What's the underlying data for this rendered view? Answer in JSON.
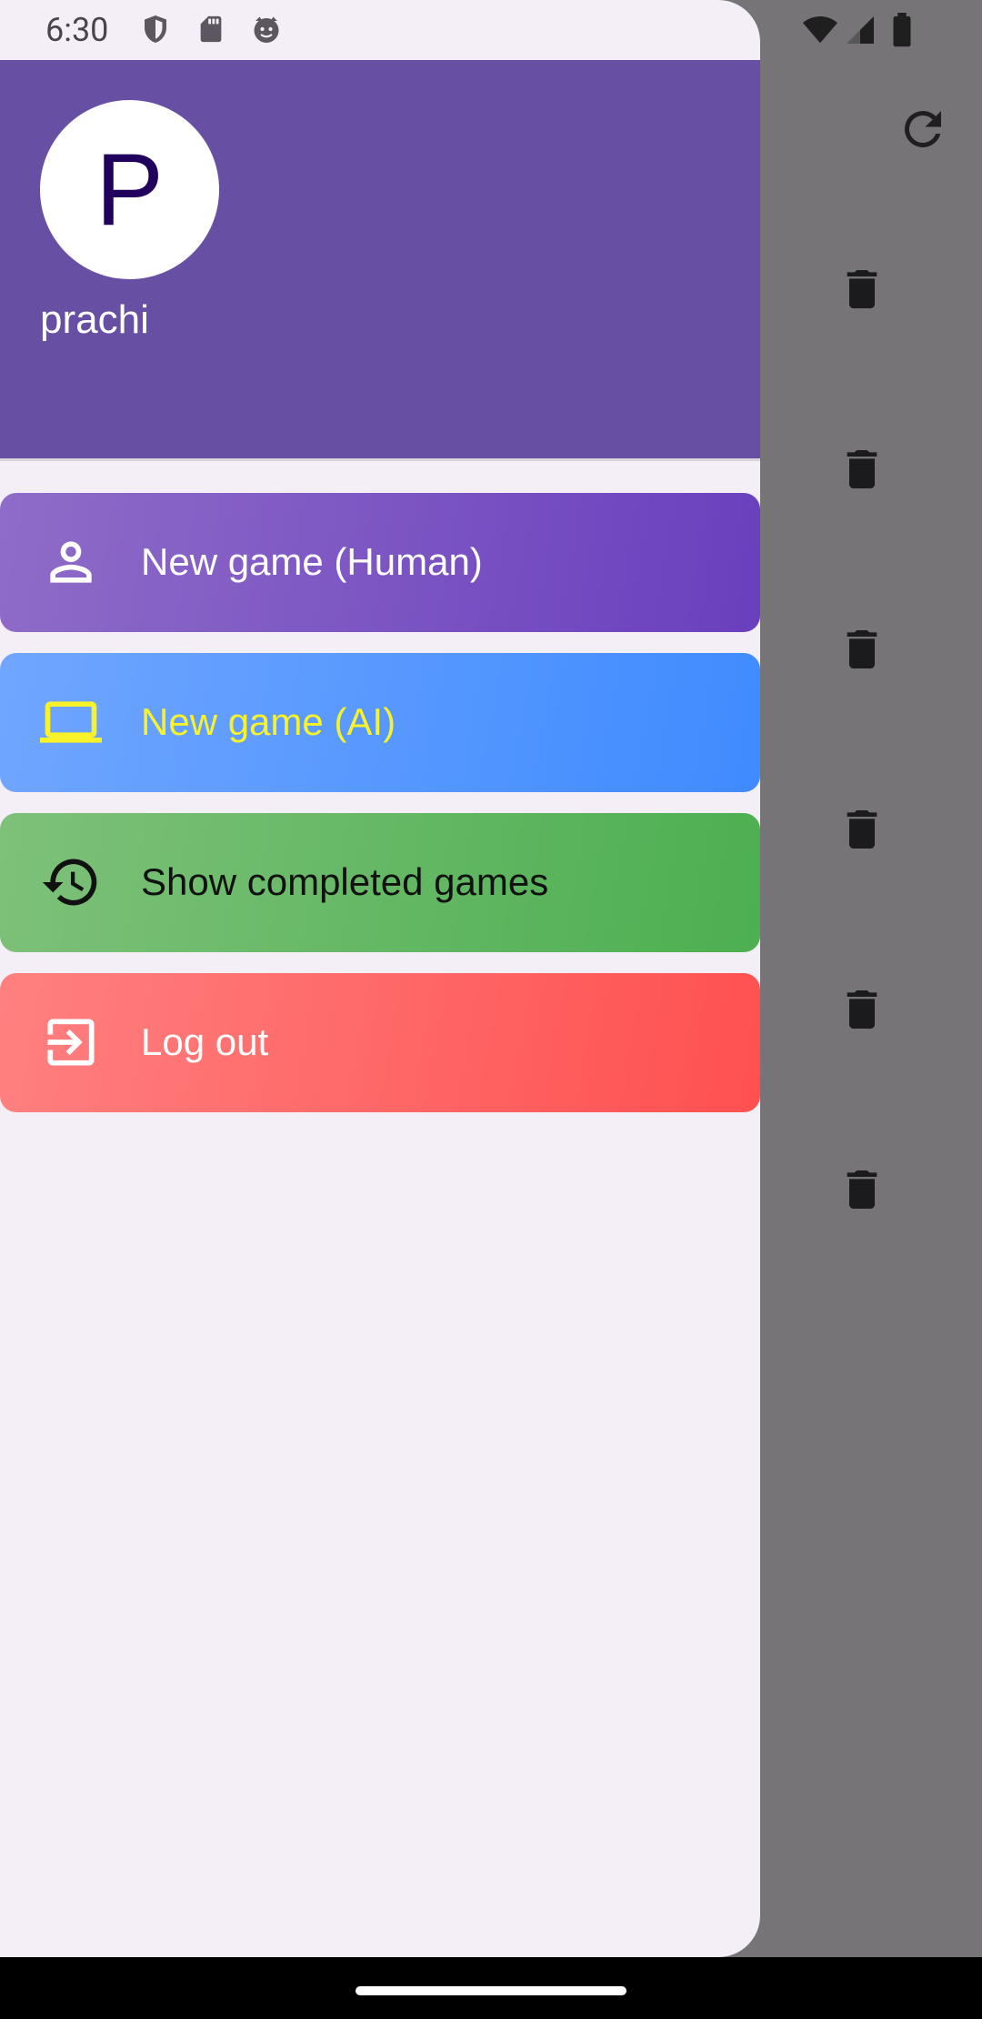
{
  "status_bar": {
    "time": "6:30",
    "icons": [
      "shield-icon",
      "sd-card-icon",
      "cat-notification-icon"
    ],
    "right_icons": [
      "wifi-icon",
      "signal-icon",
      "battery-icon"
    ]
  },
  "drawer": {
    "avatar_letter": "P",
    "username": "prachi",
    "menu": [
      {
        "label": "New game (Human)",
        "icon": "person-icon",
        "label_color": "#ffffff",
        "gradient": [
          "#8f6cc8",
          "#6a3fbe"
        ]
      },
      {
        "label": "New game (AI)",
        "icon": "laptop-icon",
        "label_color": "#f7f22a",
        "gradient": [
          "#70a6ff",
          "#3f8bff"
        ]
      },
      {
        "label": "Show completed games",
        "icon": "history-icon",
        "label_color": "#111111",
        "gradient": [
          "#7ec17a",
          "#4caf50"
        ]
      },
      {
        "label": "Log out",
        "icon": "logout-icon",
        "label_color": "#ffffff",
        "gradient": [
          "#ff8080",
          "#ff5050"
        ]
      }
    ]
  },
  "background": {
    "actions": [
      "refresh-icon",
      "trash-icon",
      "trash-icon",
      "trash-icon",
      "trash-icon",
      "trash-icon",
      "trash-icon"
    ]
  },
  "colors": {
    "header_purple": "#6750a4",
    "drawer_bg": "#f4eef7",
    "scrim": "#767477"
  }
}
